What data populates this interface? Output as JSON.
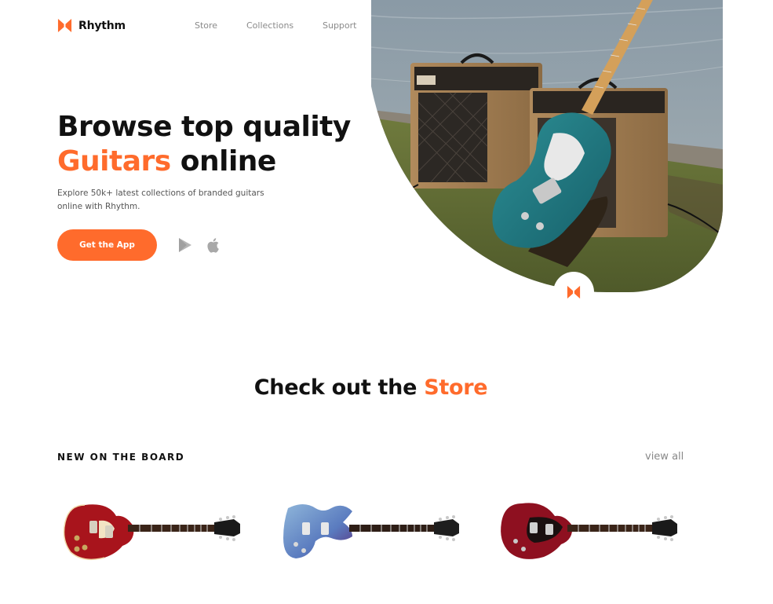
{
  "brand": {
    "name": "Rhythm",
    "accent": "#ff6b2c",
    "logo_icon": "rhythm-logo-icon"
  },
  "nav": {
    "items": [
      {
        "label": "Store"
      },
      {
        "label": "Collections"
      },
      {
        "label": "Support"
      }
    ]
  },
  "hero": {
    "title_line1": "Browse top quality",
    "title_accent": "Guitars",
    "title_rest": " online",
    "description": "Explore 50k+ latest collections of branded guitars online with Rhythm.",
    "cta_label": "Get the App",
    "store_icons": [
      "google-play-icon",
      "apple-icon"
    ],
    "image_name": "guitar-amplifiers-photo"
  },
  "store": {
    "title_prefix": "Check out the ",
    "title_accent": "Store",
    "board_label": "NEW ON THE BOARD",
    "view_all": "view all",
    "products": [
      {
        "name": "red-les-paul-guitar",
        "color": "#a8141c"
      },
      {
        "name": "blue-sg-guitar",
        "color": "#5a7bbf"
      },
      {
        "name": "cherry-les-paul-junior-guitar",
        "color": "#8e1020"
      }
    ]
  }
}
